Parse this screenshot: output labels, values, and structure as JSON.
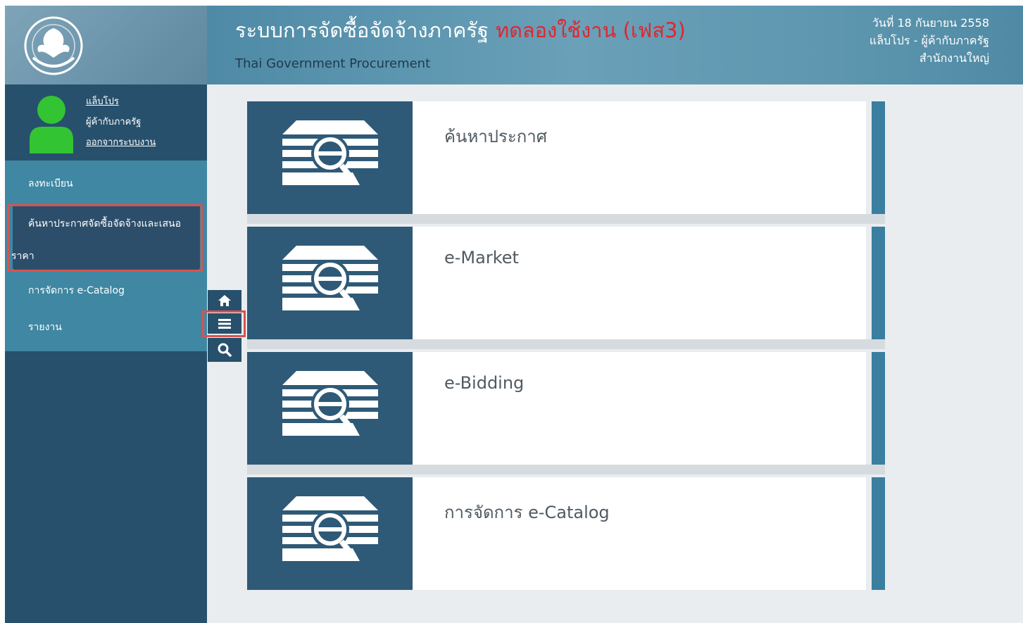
{
  "header": {
    "title": "ระบบการจัดซื้อจัดจ้างภาครัฐ",
    "trial_label": "ทดลองใช้งาน (เฟส3)",
    "subtitle": "Thai Government Procurement",
    "date": "วันที่ 18 กันยายน 2558",
    "user_line": "แล็บโปร - ผู้ค้ากับภาครัฐ",
    "office": "สำนักงานใหญ่"
  },
  "user": {
    "name": "แล็บโปร",
    "role": "ผู้ค้ากับภาครัฐ",
    "logout": "ออกจากระบบงาน"
  },
  "sidebar": {
    "items": [
      {
        "label": "ลงทะเบียน"
      },
      {
        "label_line1": "ค้นหาประกาศจัดซื้อจัดจ้างและเสนอ",
        "label_line2": "ราคา"
      },
      {
        "label": "การจัดการ e-Catalog"
      },
      {
        "label": "รายงาน"
      }
    ]
  },
  "toolbar": {
    "home_icon": "home-icon",
    "menu_icon": "menu-icon",
    "search_icon": "search-icon"
  },
  "cards": [
    {
      "label": "ค้นหาประกาศ"
    },
    {
      "label": "e-Market"
    },
    {
      "label": "e-Bidding"
    },
    {
      "label": "การจัดการ e-Catalog"
    }
  ],
  "colors": {
    "sidebar": "#27506c",
    "menu": "#3f87a3",
    "header": "#5f97b0",
    "highlight": "#d9534f",
    "trial_red": "#e0262e"
  }
}
